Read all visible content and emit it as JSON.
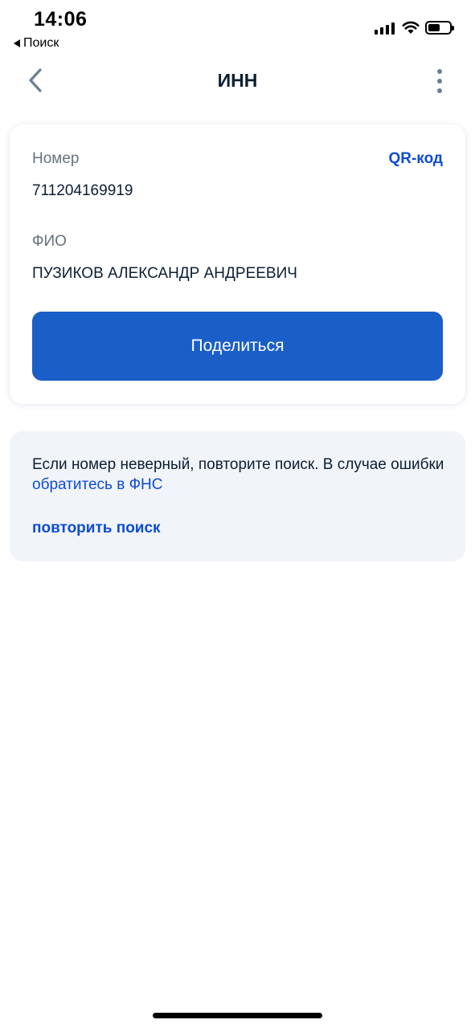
{
  "status_bar": {
    "time": "14:06",
    "back_app_label": "Поиск"
  },
  "nav": {
    "title": "ИНН",
    "back_icon": "chevron-left-icon",
    "more_icon": "more-vertical-icon"
  },
  "card": {
    "number_label": "Номер",
    "number_value": "711204169919",
    "qr_link": "QR-код",
    "name_label": "ФИО",
    "name_value": "ПУЗИКОВ АЛЕКСАНДР АНДРЕЕВИЧ",
    "share_button": "Поделиться"
  },
  "info": {
    "text": "Если номер неверный, повторите поиск. В случае ошибки ",
    "link": "обратитесь в ФНС",
    "retry_link": "повторить поиск"
  },
  "colors": {
    "primary": "#1a5ec8",
    "link": "#0d4cd3",
    "info_bg": "#f1f4f9"
  }
}
